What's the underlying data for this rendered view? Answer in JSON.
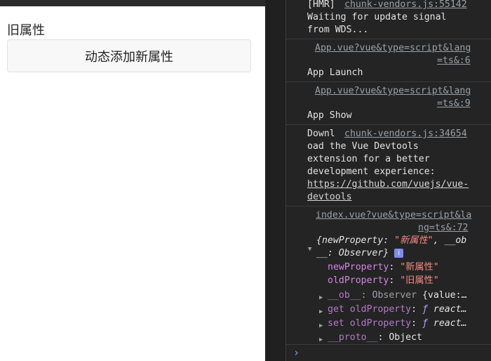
{
  "app": {
    "old_label": "旧属性",
    "button_label": "动态添加新属性"
  },
  "console": {
    "msg1": {
      "prefix": "[HMR]",
      "source": "chunk-vendors.js:55142",
      "l2": "Waiting for update signal",
      "l3": "from WDS..."
    },
    "msg2": {
      "source_a": "App.vue?vue&type=script&lang",
      "source_b": "=ts&:6",
      "text": "App Launch"
    },
    "msg3": {
      "source_a": "App.vue?vue&type=script&lang",
      "source_b": "=ts&:9",
      "text": "App Show"
    },
    "msg4": {
      "prefix": "Downl",
      "source": "chunk-vendors.js:34654",
      "l2": "oad the Vue Devtools",
      "l3": "extension for a better",
      "l4": "development experience:",
      "link_a": "https://github.com/vuejs/vue-",
      "link_b": "devtools"
    },
    "msg5": {
      "source_a": "index.vue?vue&type=script&la",
      "source_b": "ng=ts&:72",
      "obj_open": "{newProperty: ",
      "obj_newval": "\"新属性\"",
      "obj_mid": ", __ob",
      "obj_l2": "__: Observer}",
      "badge": "i",
      "p1_key": "newProperty",
      "p1_val": "\"新属性\"",
      "p2_key": "oldProperty",
      "p2_val": "\"旧属性\"",
      "p3_key": "__ob__",
      "p3_sep": ": Observer ",
      "p3_val": "{value:…",
      "p4_key": "get oldProperty",
      "p4_f": "ƒ",
      "p4_val": "react…",
      "p5_key": "set oldProperty",
      "p5_f": "ƒ",
      "p5_val": "react…",
      "p6_key": "__proto__",
      "p6_val": ": Object"
    },
    "prompt": "›"
  }
}
